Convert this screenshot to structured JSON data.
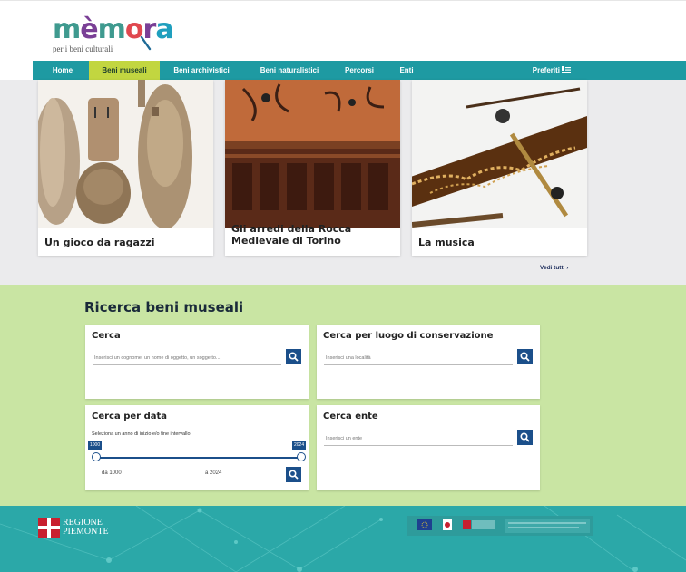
{
  "header": {
    "logo_word": "mèmora",
    "logo_subtitle": "per i beni culturali"
  },
  "nav": {
    "items": [
      {
        "label": "Home",
        "active": false
      },
      {
        "label": "Beni museali",
        "active": true
      },
      {
        "label": "Beni archivistici",
        "active": false
      },
      {
        "label": "Beni naturalistici",
        "active": false
      },
      {
        "label": "Percorsi",
        "active": false
      },
      {
        "label": "Enti",
        "active": false
      }
    ],
    "favorites_label": "Preferiti"
  },
  "cards": [
    {
      "title": "Un gioco da ragazzi"
    },
    {
      "title": "Gli arredi della Rocca Medievale di Torino"
    },
    {
      "title": "La musica"
    }
  ],
  "see_all_label": "Vedi tutti",
  "search": {
    "title": "Ricerca beni museali",
    "cerca": {
      "title": "Cerca",
      "placeholder": "Inserisci un cognome, un nome di oggetto, un soggetto..."
    },
    "luogo": {
      "title": "Cerca per luogo di conservazione",
      "placeholder": "Inserisci una località"
    },
    "data": {
      "title": "Cerca per data",
      "hint": "Seleziona un anno di inizio e/o fine intervallo",
      "min_tag": "1000",
      "max_tag": "2024",
      "from_label": "da 1000",
      "to_label": "a 2024",
      "range_start": 1000,
      "range_end": 2024
    },
    "ente": {
      "title": "Cerca ente",
      "placeholder": "Inserisci un ente"
    }
  },
  "footer": {
    "regione_line1": "REGIONE",
    "regione_line2": "PIEMONTE"
  },
  "colors": {
    "nav_bg": "#1e9aa2",
    "nav_active": "#c2d640",
    "search_bg": "#c9e5a3",
    "button": "#1b4f8a",
    "footer_bg": "#2ba8a8"
  }
}
